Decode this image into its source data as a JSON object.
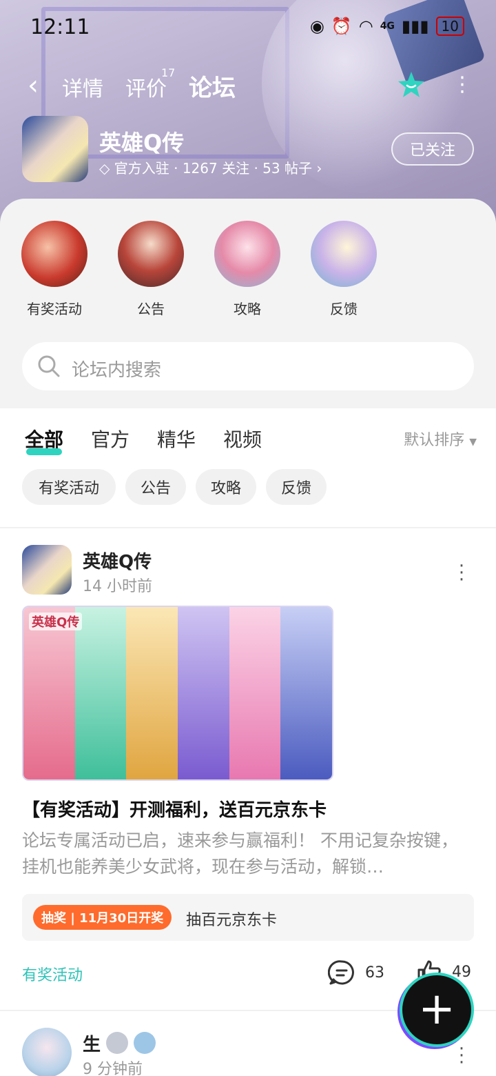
{
  "status_bar": {
    "time": "12:11",
    "network": "4G",
    "battery": "10"
  },
  "nav": {
    "tabs": [
      {
        "label": "详情"
      },
      {
        "label": "评价",
        "badge": "17"
      },
      {
        "label": "论坛"
      }
    ],
    "active_tab": "论坛"
  },
  "game": {
    "name": "英雄Q传",
    "official": "官方入驻",
    "followers": "1267 关注",
    "posts": "53 帖子",
    "follow_button": "已关注"
  },
  "categories": [
    {
      "label": "有奖活动"
    },
    {
      "label": "公告"
    },
    {
      "label": "攻略"
    },
    {
      "label": "反馈"
    }
  ],
  "search": {
    "placeholder": "论坛内搜索"
  },
  "feed_tabs": {
    "items": [
      {
        "label": "全部"
      },
      {
        "label": "官方"
      },
      {
        "label": "精华"
      },
      {
        "label": "视频"
      }
    ],
    "active": "全部",
    "sort": "默认排序"
  },
  "filter_chips": [
    {
      "label": "有奖活动"
    },
    {
      "label": "公告"
    },
    {
      "label": "攻略"
    },
    {
      "label": "反馈"
    }
  ],
  "posts": [
    {
      "author": "英雄Q传",
      "time": "14 小时前",
      "banner_logo": "英雄Q传",
      "title": "【有奖活动】开测福利，送百元京东卡",
      "desc": "论坛专属活动已启，速来参与赢福利！ 不用记复杂按键，挂机也能养美少女武将，现在参与活动，解锁…",
      "lottery_tag": "抽奖 | 11月30日开奖",
      "lottery_text": "抽百元京东卡",
      "tag": "有奖活动",
      "comments": "63",
      "likes": "49"
    },
    {
      "author": "生",
      "time": "9 分钟前"
    }
  ],
  "colors": {
    "accent": "#2ed4c0",
    "lottery": "#ff6b2c",
    "tag": "#2ec3b8"
  }
}
